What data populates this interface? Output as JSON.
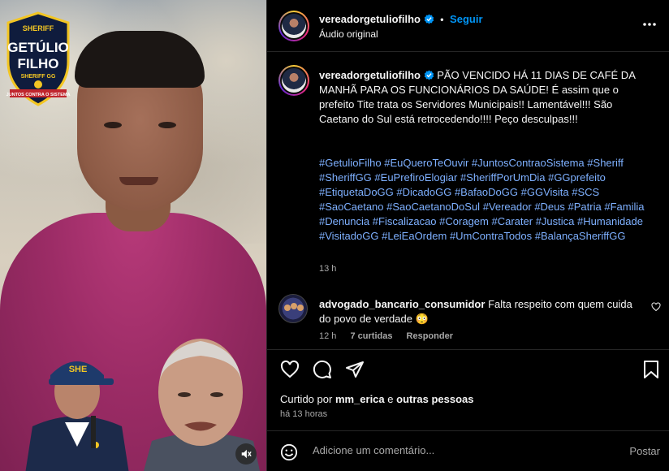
{
  "header": {
    "username": "vereadorgetuliofilho",
    "separator": "•",
    "follow_label": "Seguir",
    "audio_label": "Áudio original",
    "more_icon": "more-horizontal-icon"
  },
  "badge": {
    "top": "SHERIFF",
    "name_line1": "GETÚLIO",
    "name_line2": "FILHO",
    "sub": "SHERIFF GG",
    "ribbon": "JUNTOS CONTRA O SISTEMA"
  },
  "inset": {
    "cap_text": "SHE"
  },
  "caption": {
    "username": "vereadorgetuliofilho",
    "text": "PÃO VENCIDO HÁ 11 DIAS DE CAFÉ DA MANHÃ PARA OS FUNCIONÁRIOS DA SAÚDE! É assim que o prefeito Tite trata os Servidores Municipais!! Lamentável!!! São Caetano do Sul está retrocedendo!!!! Peço desculpas!!!",
    "hashtags": [
      "#GetulioFilho",
      "#EuQueroTeOuvir",
      "#JuntosContraoSistema",
      "#Sheriff",
      "#SheriffGG",
      "#EuPrefiroElogiar",
      "#SheriffPorUmDia",
      "#GGprefeito",
      "#EtiquetaDoGG",
      "#DicadoGG",
      "#BafaoDoGG",
      "#GGVisita",
      "#SCS",
      "#SaoCaetano",
      "#SaoCaetanoDoSul",
      "#Vereador",
      "#Deus",
      "#Patria",
      "#Familia",
      "#Denuncia",
      "#Fiscalizacao",
      "#Coragem",
      "#Carater",
      "#Justica",
      "#Humanidade",
      "#VisitadoGG",
      "#LeiEaOrdem",
      "#UmContraTodos",
      "#BalançaSheriffGG"
    ],
    "time": "13 h"
  },
  "comment": {
    "username": "advogado_bancario_consumidor",
    "text": "Falta respeito com quem cuida do povo de verdade 😳",
    "time": "12 h",
    "likes": "7 curtidas",
    "reply_label": "Responder"
  },
  "engagement": {
    "liked_prefix": "Curtido por",
    "liked_user": "mm_erica",
    "liked_and": "e",
    "liked_others": "outras pessoas",
    "ago": "há 13 horas"
  },
  "add_comment": {
    "placeholder": "Adicione um comentário...",
    "post_label": "Postar"
  },
  "colors": {
    "accent": "#0095f6",
    "hashtag": "#7eb0ff",
    "background": "#000000"
  }
}
